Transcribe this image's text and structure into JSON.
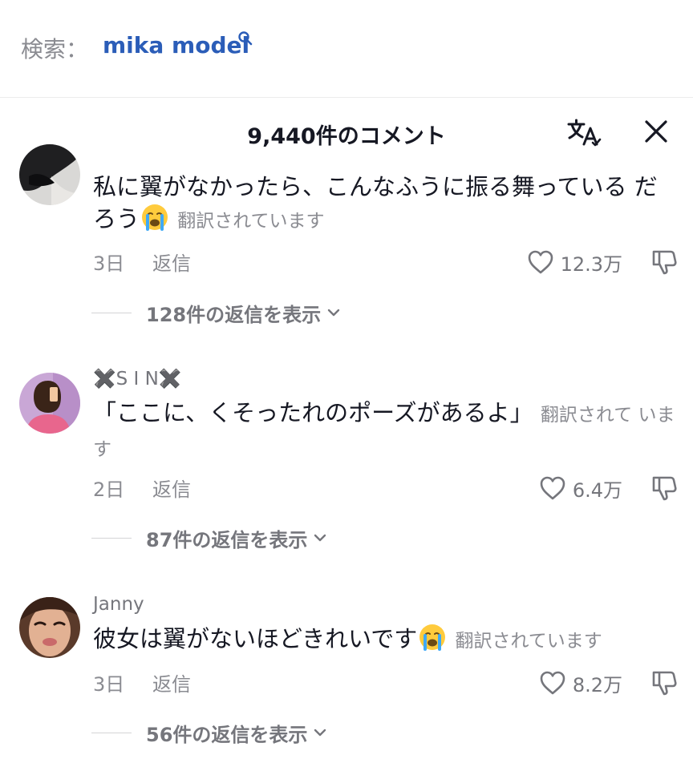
{
  "search": {
    "label": "検索：",
    "query": "mika model"
  },
  "header": {
    "title": "9,440件のコメント"
  },
  "comments": [
    {
      "username": "",
      "text": "私に翼がなかったら、こんなふうに振る舞っている だろう",
      "emoji": "crying-face",
      "translated_label": "翻訳されています",
      "date": "3日",
      "reply_label": "返信",
      "likes": "12.3万",
      "view_replies": "128件の返信を表示"
    },
    {
      "username": "✖️S I N✖️",
      "text": "「ここに、くそったれのポーズがあるよ」",
      "translated_label": "翻訳されて います",
      "date": "2日",
      "reply_label": "返信",
      "likes": "6.4万",
      "view_replies": "87件の返信を表示"
    },
    {
      "username": "Janny",
      "text": "彼女は翼がないほどきれいです",
      "emoji": "crying-face",
      "translated_label": "翻訳されています",
      "date": "3日",
      "reply_label": "返信",
      "likes": "8.2万",
      "view_replies": "56件の返信を表示"
    }
  ],
  "colors": {
    "query_link": "#2b5db8",
    "primary_text": "#161823",
    "secondary_text": "#8a8b91",
    "divider": "#ececec"
  },
  "icons": [
    "search-icon",
    "translate-icon",
    "close-icon",
    "heart-icon",
    "dislike-icon",
    "chevron-down-icon",
    "crying-face-emoji"
  ]
}
